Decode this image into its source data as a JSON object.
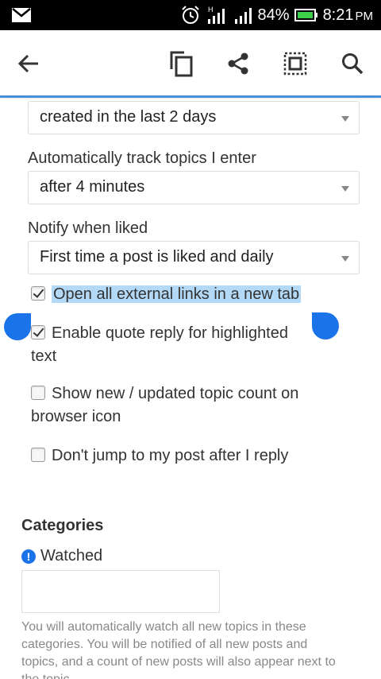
{
  "status_bar": {
    "battery": "84%",
    "time": "8:21",
    "ampm": "PM",
    "network_letter": "H"
  },
  "toolbar": {
    "back_icon": "arrow-left-icon",
    "copy_icon": "copy-icon",
    "share_icon": "share-icon",
    "select_all_icon": "select-all-icon",
    "search_icon": "search-icon"
  },
  "settings": {
    "select_new_topics": {
      "value": "created in the last 2 days"
    },
    "track_topics": {
      "label": "Automatically track topics I enter",
      "value": "after 4 minutes"
    },
    "notify_liked": {
      "label": "Notify when liked",
      "value": "First time a post is liked and daily"
    },
    "checkboxes": [
      {
        "label": "Open all external links in a new tab",
        "checked": true
      },
      {
        "label": "Enable quote reply for highlighted text",
        "checked": true
      },
      {
        "label": "Show new / updated topic count on browser icon",
        "checked": false
      },
      {
        "label": "Don't jump to my post after I reply",
        "checked": false
      }
    ]
  },
  "categories": {
    "title": "Categories",
    "watched_label": "Watched",
    "help_text": "You will automatically watch all new topics in these categories. You will be notified of all new posts and topics, and a count of new posts will also appear next to the topic."
  },
  "colors": {
    "accent": "#4a90d9",
    "selection_handle": "#1a73e8",
    "selection_highlight": "#b3d9f7"
  }
}
